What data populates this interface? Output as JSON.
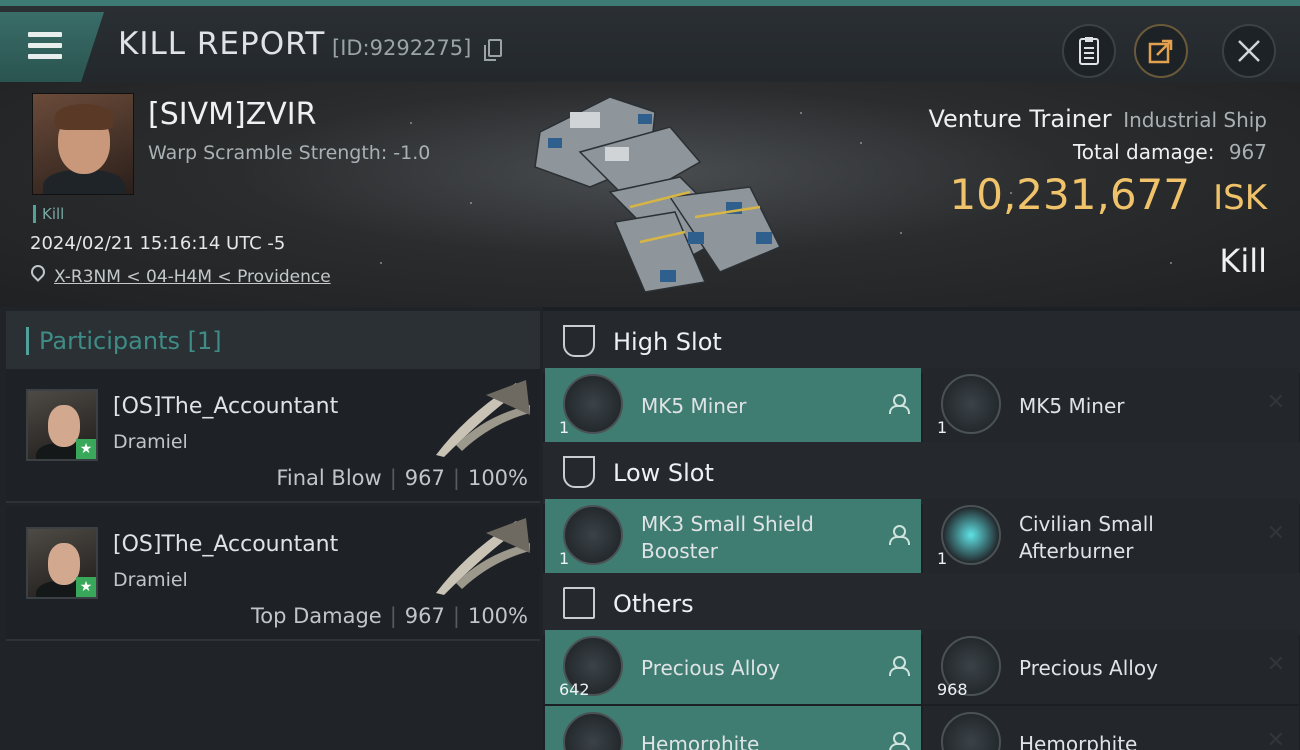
{
  "header": {
    "title": "KILL REPORT",
    "report_id": "[ID:9292275]"
  },
  "victim": {
    "name": "[SIVM]ZVIR",
    "warp_scramble": "Warp Scramble Strength: -1.0",
    "tag": "Kill",
    "datetime": "2024/02/21 15:16:14 UTC -5",
    "location": "X-R3NM < 04-H4M < Providence",
    "ship_name": "Venture Trainer",
    "ship_class": "Industrial Ship",
    "total_damage_label": "Total damage:",
    "total_damage": "967",
    "isk_value": "10,231,677",
    "isk_unit": "ISK",
    "result": "Kill"
  },
  "participants": {
    "header": "Participants [1]",
    "rows": [
      {
        "name": "[OS]The_Accountant",
        "corp": "Dramiel",
        "role": "Final Blow",
        "damage": "967",
        "percent": "100%"
      },
      {
        "name": "[OS]The_Accountant",
        "corp": "Dramiel",
        "role": "Top Damage",
        "damage": "967",
        "percent": "100%"
      }
    ]
  },
  "slots": {
    "high": {
      "label": "High Slot",
      "destroyed": {
        "name": "MK5 Miner",
        "qty": "1"
      },
      "dropped": {
        "name": "MK5 Miner",
        "qty": "1"
      }
    },
    "low": {
      "label": "Low Slot",
      "destroyed": {
        "name_line1": "MK3 Small Shield",
        "name_line2": "Booster",
        "qty": "1"
      },
      "dropped": {
        "name_line1": "Civilian Small",
        "name_line2": "Afterburner",
        "qty": "1"
      }
    },
    "others": {
      "label": "Others",
      "items": [
        {
          "destroyed": {
            "name": "Precious Alloy",
            "qty": "642"
          },
          "dropped": {
            "name": "Precious Alloy",
            "qty": "968"
          }
        },
        {
          "destroyed": {
            "name": "Hemorphite",
            "qty": ""
          },
          "dropped": {
            "name": "Hemorphite",
            "qty": ""
          }
        }
      ]
    }
  },
  "colors": {
    "accent_teal": "#3f7d72",
    "isk_gold": "#f0c36a",
    "share_orange": "#e3a04e"
  },
  "icons": {
    "menu": "hamburger-icon",
    "copy": "copy-icon",
    "notes": "clipboard-icon",
    "share": "share-icon",
    "close": "close-icon"
  }
}
